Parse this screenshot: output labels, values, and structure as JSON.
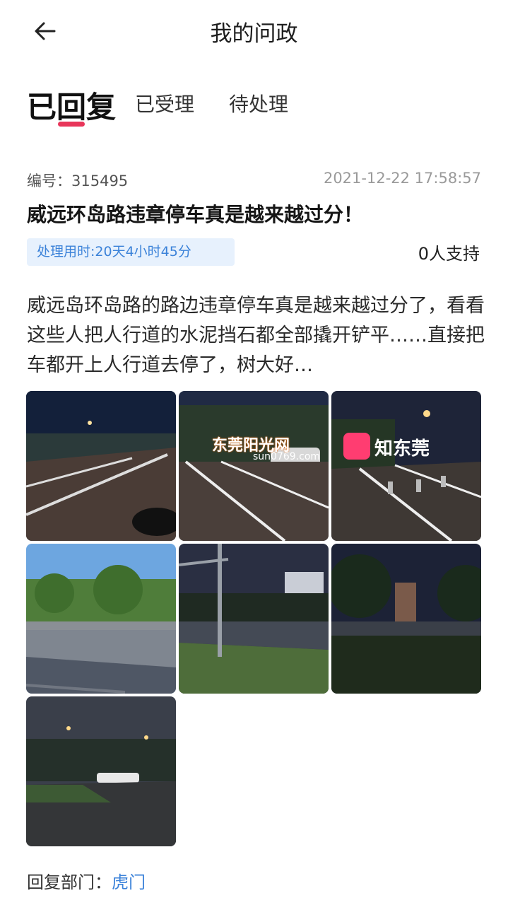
{
  "header": {
    "title": "我的问政"
  },
  "tabs": [
    {
      "label": "已回复",
      "active": true
    },
    {
      "label": "已受理",
      "active": false
    },
    {
      "label": "待处理",
      "active": false
    }
  ],
  "post": {
    "id_label": "编号：",
    "id_value": "315495",
    "datetime": "2021-12-22 17:58:57",
    "title": "威远环岛路违章停车真是越来越过分！",
    "duration": "处理用时:20天4小时45分",
    "support": "0人支持",
    "content": "威远岛环岛路的路边违章停车真是越来越过分了，看看这些人把人行道的水泥挡石都全部撬开铲平……直接把车都开上人行道去停了，树大好…",
    "image_count": 7
  },
  "watermark": {
    "brand1": "东莞阳光网",
    "domain": "sun0769.com",
    "brand2": "知东莞"
  },
  "reply": {
    "label": "回复部门：",
    "dept": "虎门"
  },
  "colors": {
    "accent": "#e8365a",
    "link": "#3b82d9",
    "badge_bg": "#e7f1fd"
  }
}
